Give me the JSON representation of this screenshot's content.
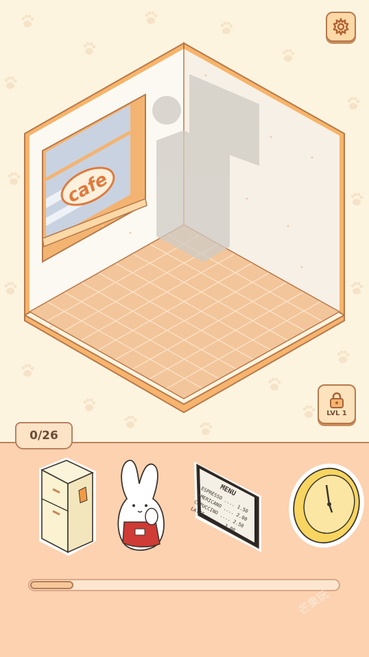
{
  "room": {
    "window_sign": "cafe"
  },
  "controls": {
    "settings_icon": "gear-icon",
    "lock_icon": "padlock-icon",
    "lock_label": "LVL 1"
  },
  "inventory": {
    "counter": "0/26",
    "items": [
      {
        "id": "fridge",
        "icon": "fridge-icon"
      },
      {
        "id": "bunny",
        "icon": "bunny-barista-icon"
      },
      {
        "id": "menu-board",
        "icon": "menu-board-icon",
        "title": "MENU",
        "lines": [
          "ESPRESSO .... 1.50",
          "AMERICANO .... 2.00",
          "CAPUCCINO .... 2.50",
          "LATTE .......3.00"
        ]
      },
      {
        "id": "clock",
        "icon": "wall-clock-icon"
      }
    ],
    "progress_fraction": 0.14
  },
  "watermark": "芒果玩",
  "colors": {
    "background": "#fdf4e0",
    "tray": "#fdd2b0",
    "accent_orange": "#f7b878",
    "outline_brown": "#b7784a"
  }
}
